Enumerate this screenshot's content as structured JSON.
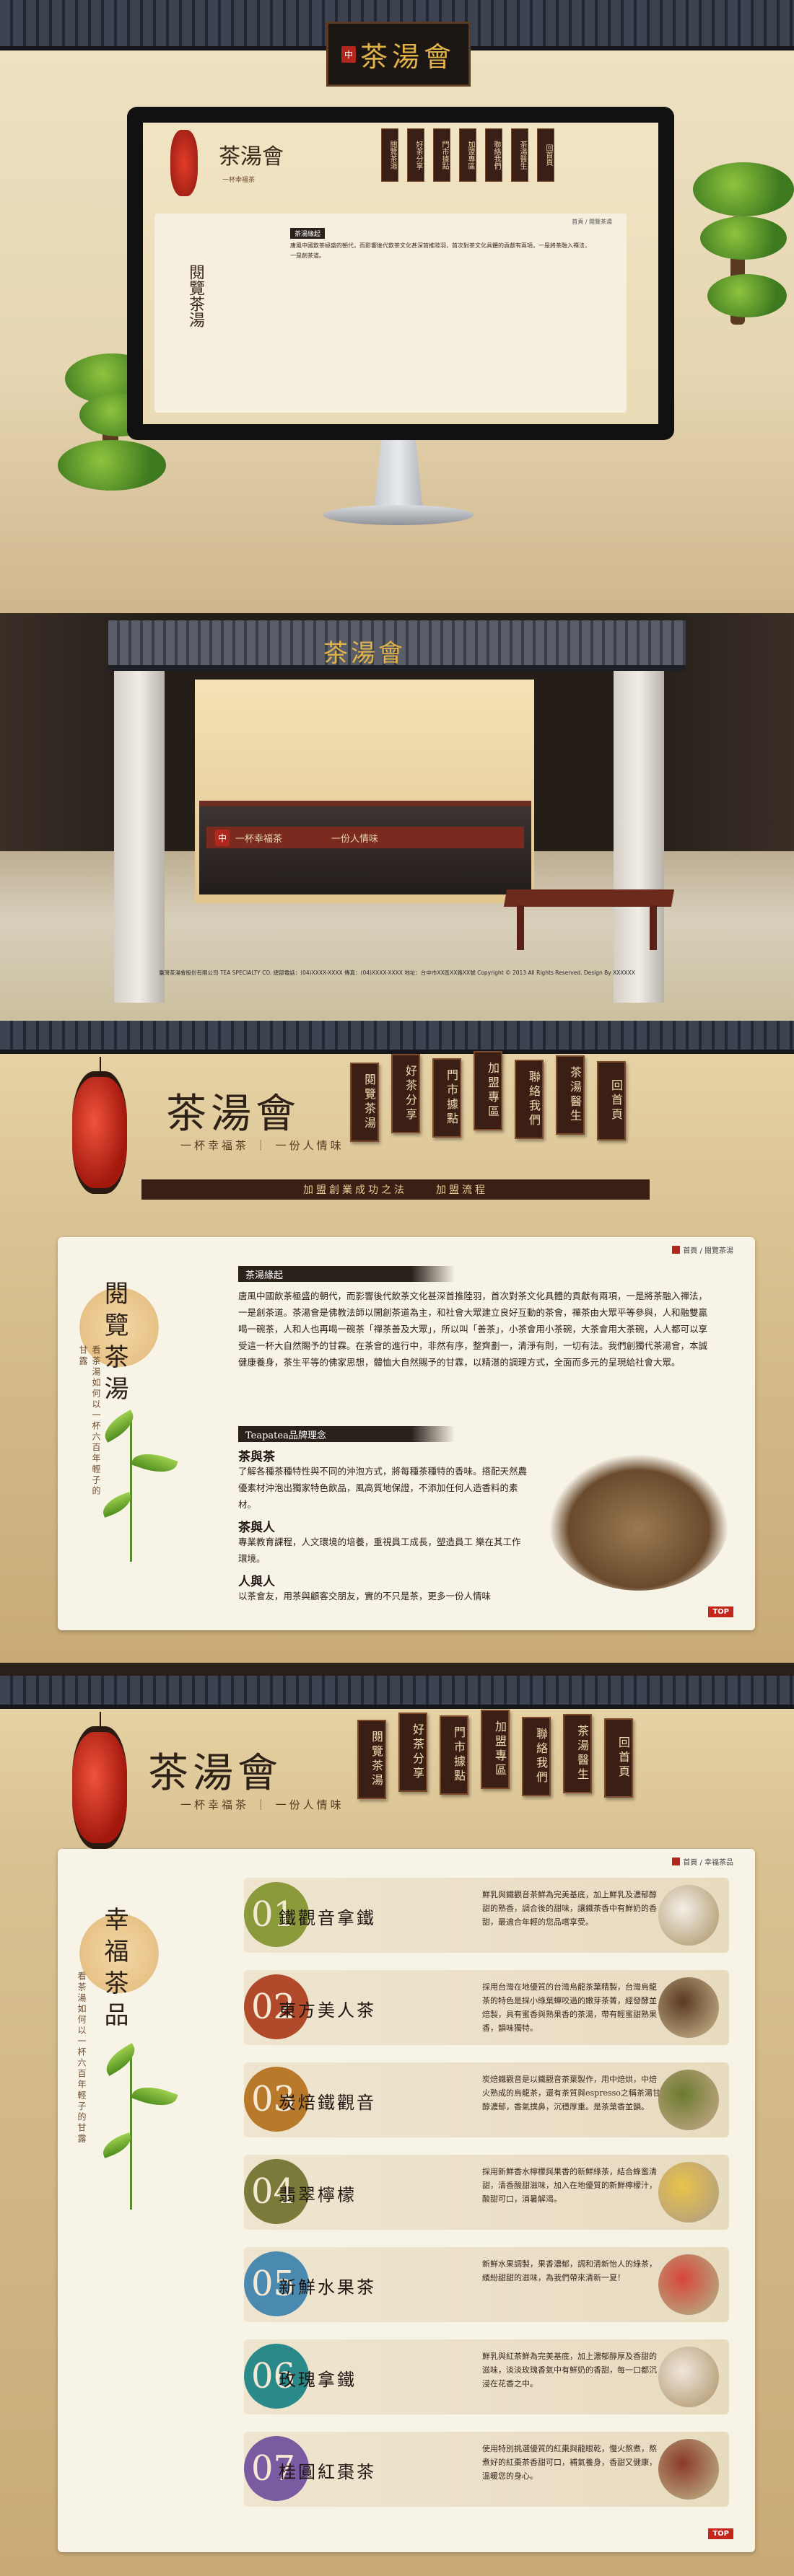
{
  "brand": {
    "logo": "茶湯會",
    "seal": "中",
    "slogan_a": "一杯幸福茶",
    "slogan_b": "一份人情味"
  },
  "nav_tags": [
    "閱覽茶湯",
    "好茶分享",
    "門市據點",
    "加盟專區",
    "聯絡我們",
    "茶湯醫生",
    "回首頁"
  ],
  "nav_bar": [
    "加盟創業成功之法",
    "加盟流程"
  ],
  "monitor_page": {
    "back": "首頁 / 閱覽茶湯",
    "heading": "茶湯緣起",
    "text": "唐風中國飲茶極盛的朝代，而影響後代飲茶文化甚深首推陸羽，首次對茶文化具體的貢獻有兩項，一是將茶融入禪法，一是創茶道。"
  },
  "shop": {
    "sign": "茶湯會",
    "counter_a": "一杯幸福茶",
    "counter_b": "一份人情味",
    "footer": "臺灣茶湯會股份有限公司 TEA SPECIALTY CO. 總部電話：(04)XXXX-XXXX 傳真：(04)XXXX-XXXX 地址：台中市XX區XX路XX號 Copyright © 2013 All Rights Reserved. Design By XXXXXX"
  },
  "about": {
    "breadcrumb": "首頁 / 閱覽茶湯",
    "vertical_title": "閱覽茶湯",
    "vertical_sub": "看茶湯如何以一杯六百年輕子的甘露",
    "heading": "茶湯緣起",
    "para": "唐風中國飲茶極盛的朝代，而影響後代飲茶文化甚深首推陸羽，首次對茶文化具體的貢獻有兩項，一是將茶融入禪法，一是創茶道。茶湯會是佛教法師以開創茶道為主，和社會大眾建立良好互動的茶會，禪茶由大眾平等參與，人和融雙贏喝一碗茶，人和人也再喝一碗茶「禪茶善及大眾」，所以叫「善茶」，小茶會用小茶碗，大茶會用大茶碗，人人都可以享受這一杯大自然賜予的甘霖。在茶會的進行中，非然有序，整齊劃一，清淨有則，一切有法。我們創獨代茶湯會，本誠健康養身，茶生平等的佛家思想，體恤大自然賜予的甘霖，以精湛的調理方式，全面而多元的呈現給社會大眾。",
    "concept_heading": "Teapatea品牌理念",
    "h1": "茶與茶",
    "p1": "了解各種茶種特性與不同的沖泡方式，將每種茶種特的香味。搭配天然農優素材沖泡出獨家特色飲品，風高質地保證，不添加任何人造香料的素材。",
    "h2": "茶與人",
    "p2": "專業教育課程，人文環境的培養，重視員工成長，塑造員工 樂在其工作環境。",
    "h3": "人與人",
    "p3": "以茶會友，用茶與顧客交朋友，實的不只是茶，更多一份人情味",
    "top": "TOP"
  },
  "menu": {
    "breadcrumb": "首頁 / 幸福茶品",
    "vertical_title": "幸福茶品",
    "vertical_sub": "看茶湯如何以一杯六百年輕子的甘露",
    "products": [
      {
        "num": "01",
        "name": "鐵觀音拿鐵",
        "desc": "鮮乳與鐵觀音茶鮮為完美基底，加上鮮乳及濃郁醇甜的熟香，調合後的甜味，讓鐵茶香中有鮮奶的香甜，最適合年輕的您品嚐享受。",
        "color": "#8a9a3a"
      },
      {
        "num": "02",
        "name": "東方美人茶",
        "desc": "採用台灣在地優質的台灣烏龍茶葉精製，台灣烏龍茶的特色是採小綠葉蟬咬過的嫩芽茶菁，經發酵並焙製，具有蜜香與熟果香的茶湯，帶有輕蜜甜熟果香，韻味獨特。",
        "color": "#b04a2a"
      },
      {
        "num": "03",
        "name": "炭焙鐵觀音",
        "desc": "炭焙鐵觀音是以鐵觀音茶葉製作，用中焙烘，中焙火熟成的烏龍茶，還有茶質與espresso之稱茶湯甘醇濃郁，香氣撲鼻，沉穩厚重。是茶葉香並韻。",
        "color": "#b87a2a"
      },
      {
        "num": "04",
        "name": "翡翠檸檬",
        "desc": "採用新鮮香水檸檬與果香的新鮮綠茶，結合蜂蜜清甜，清香酸甜滋味，加入在地優質的新鮮檸檬汁，酸甜可口，消暑解渴。",
        "color": "#7a7a3a"
      },
      {
        "num": "05",
        "name": "新鮮水果茶",
        "desc": "新鮮水果調製，果香濃郁，調和清新怡人的綠茶，繽紛甜甜的滋味，為我們帶來清新一夏！",
        "color": "#4a8ab0"
      },
      {
        "num": "06",
        "name": "玫瑰拿鐵",
        "desc": "鮮乳與紅茶鮮為完美基底，加上濃郁醇厚及香甜的滋味，淡淡玫瑰香氣中有鮮奶的香甜，每一口都沉浸在花香之中。",
        "color": "#2a8a8a"
      },
      {
        "num": "07",
        "name": "桂圓紅棗茶",
        "desc": "使用特別挑選優質的紅棗與龍眼乾，慢火熬煮，熬煮好的紅棗茶香甜可口，補氣養身，香甜又健康，溫暖您的身心。",
        "color": "#7a5aa0"
      }
    ],
    "top": "TOP"
  }
}
